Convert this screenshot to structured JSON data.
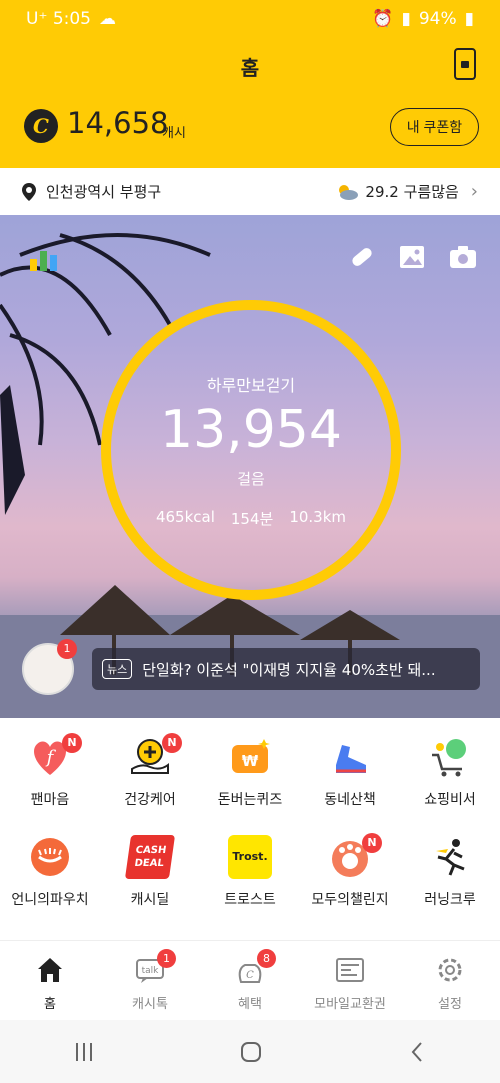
{
  "status": {
    "carrier": "U⁺ 5:05",
    "battery": "94%"
  },
  "header": {
    "title": "홈",
    "cash_amount": "14,658",
    "cash_unit": "캐시",
    "coupon_label": "내 쿠폰함"
  },
  "location": {
    "name": "인천광역시 부평구",
    "weather": "29.2 구름많음"
  },
  "pedometer": {
    "label": "하루만보걷기",
    "steps": "13,954",
    "unit": "걸음",
    "kcal": "465kcal",
    "minutes": "154분",
    "distance": "10.3km"
  },
  "news": {
    "tag": "뉴스",
    "headline": "단일화? 이준석 \"이재명 지지율 40%초반 돼...",
    "badge": "1"
  },
  "menu": [
    {
      "label": "팬마음",
      "badge": "N"
    },
    {
      "label": "건강케어",
      "badge": "N"
    },
    {
      "label": "돈버는퀴즈",
      "badge": ""
    },
    {
      "label": "동네산책",
      "badge": ""
    },
    {
      "label": "쇼핑비서",
      "badge": ""
    },
    {
      "label": "언니의파우치",
      "badge": ""
    },
    {
      "label": "캐시딜",
      "badge": ""
    },
    {
      "label": "트로스트",
      "badge": ""
    },
    {
      "label": "모두의챌린지",
      "badge": "N"
    },
    {
      "label": "러닝크루",
      "badge": ""
    }
  ],
  "menu_icon_text": {
    "cashdeal": "CASH DEAL",
    "trost": "Trost."
  },
  "tabs": [
    {
      "label": "홈",
      "badge": ""
    },
    {
      "label": "캐시톡",
      "badge": "1"
    },
    {
      "label": "혜택",
      "badge": "8"
    },
    {
      "label": "모바일교환권",
      "badge": ""
    },
    {
      "label": "설정",
      "badge": ""
    }
  ],
  "colors": {
    "accent": "#ffcb05",
    "badge": "#f03e3e"
  }
}
